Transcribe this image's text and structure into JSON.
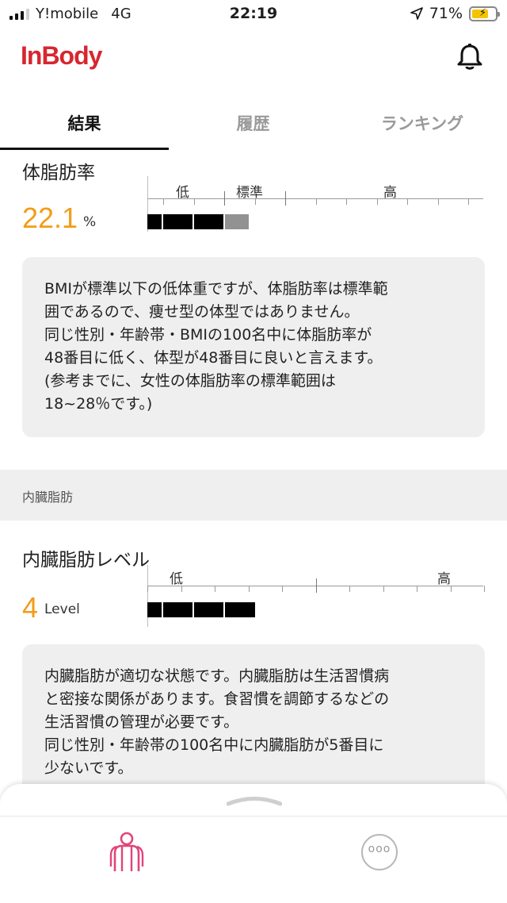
{
  "status_bar": {
    "carrier": "Y!mobile",
    "network": "4G",
    "time": "22:19",
    "battery_percent": "71%",
    "battery_level": 0.71,
    "location_icon": "location-arrow-icon",
    "battery_icon": "battery-charging-icon"
  },
  "header": {
    "logo": "InBody",
    "notification_icon": "bell-icon",
    "brand_color": "#d8262f"
  },
  "tabs": [
    {
      "label": "結果",
      "active": true
    },
    {
      "label": "履歴",
      "active": false
    },
    {
      "label": "ランキング",
      "active": false
    }
  ],
  "body_fat": {
    "title": "体脂肪率",
    "value": "22.1",
    "unit": "%",
    "scale_labels": {
      "low": "低",
      "standard": "標準",
      "high": "高"
    },
    "bar_filled_segments": 3,
    "bar_standard_segments": 1,
    "description": [
      "BMIが標準以下の低体重ですが、体脂肪率は標準範",
      "囲であるので、痩せ型の体型ではありません。",
      "同じ性別・年齢帯・BMIの100名中に体脂肪率が",
      "48番目に低く、体型が48番目に良いと言えます。",
      "(参考までに、女性の体脂肪率の標準範囲は",
      "18~28％です。)"
    ]
  },
  "visceral_section": {
    "header": "内臓脂肪",
    "title": "内臓脂肪レベル",
    "value": "4",
    "unit": "Level",
    "scale_labels": {
      "low": "低",
      "high": "高"
    },
    "bar_filled_segments": 4,
    "description": [
      "内臓脂肪が適切な状態です。内臓脂肪は生活習慣病",
      "と密接な関係があります。食習慣を調節するなどの",
      "生活習慣の管理が必要です。",
      "同じ性別・年齢帯の100名中に内臓脂肪が5番目に",
      "少ないです。"
    ]
  },
  "bottom_nav": {
    "body_icon": "body-composition-icon",
    "more_icon": "more-icon",
    "accent_color": "#e0457b",
    "value_color": "#f39c19"
  }
}
